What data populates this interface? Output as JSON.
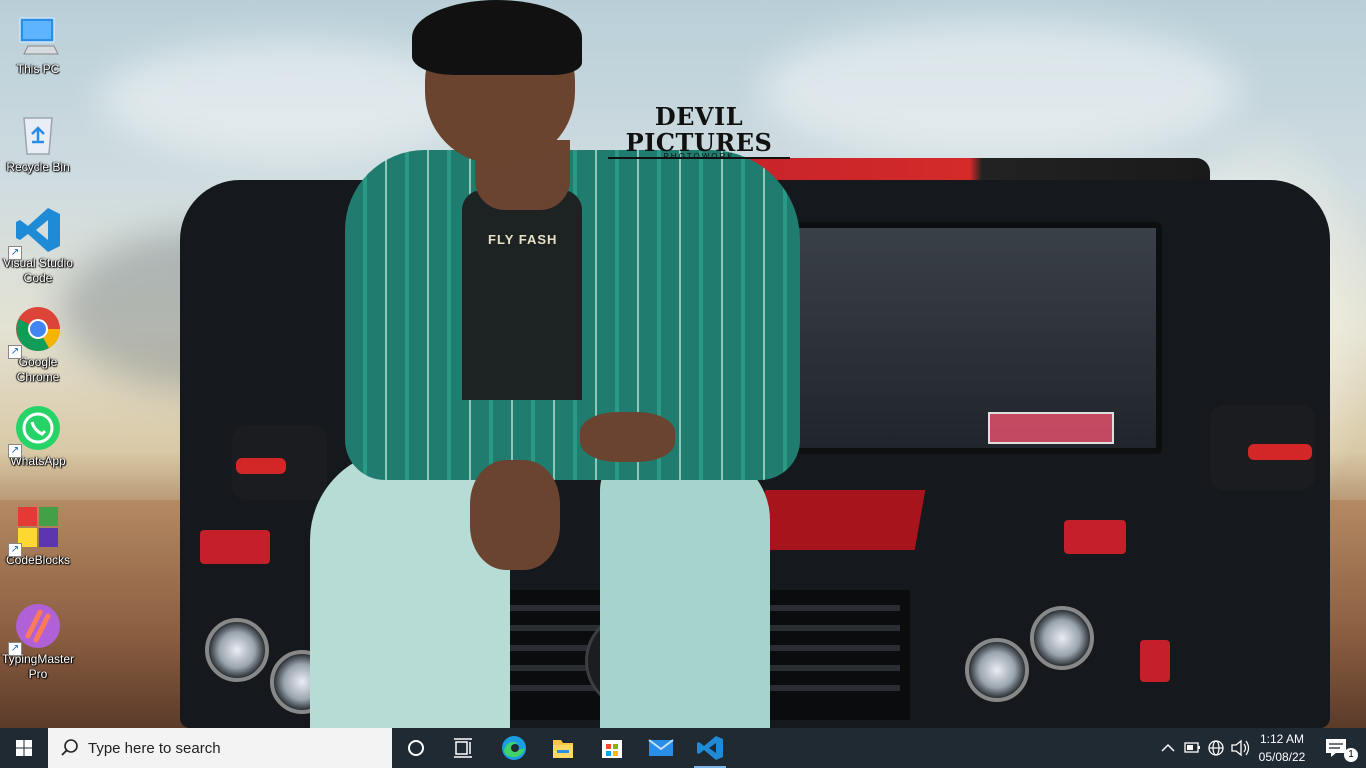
{
  "wallpaper": {
    "watermark_title": "DEVIL PICTURES",
    "watermark_subtitle": "PHOTOWORK",
    "shirt_text": "FLY FASH"
  },
  "desktop": {
    "icons": [
      {
        "label": "This PC",
        "icon": "this-pc-icon",
        "shortcut": false
      },
      {
        "label": "Recycle Bin",
        "icon": "recycle-bin-icon",
        "shortcut": false
      },
      {
        "label": "Visual Studio Code",
        "icon": "vscode-icon",
        "shortcut": true
      },
      {
        "label": "Google Chrome",
        "icon": "chrome-icon",
        "shortcut": true
      },
      {
        "label": "WhatsApp",
        "icon": "whatsapp-icon",
        "shortcut": true
      },
      {
        "label": "CodeBlocks",
        "icon": "codeblocks-icon",
        "shortcut": true
      },
      {
        "label": "TypingMaster Pro",
        "icon": "typingmaster-icon",
        "shortcut": true
      }
    ]
  },
  "taskbar": {
    "search_placeholder": "Type here to search",
    "pinned": [
      {
        "name": "cortana",
        "icon": "cortana-icon"
      },
      {
        "name": "task-view",
        "icon": "task-view-icon"
      },
      {
        "name": "edge",
        "icon": "edge-icon"
      },
      {
        "name": "file-explorer",
        "icon": "folder-icon"
      },
      {
        "name": "microsoft-store",
        "icon": "store-icon"
      },
      {
        "name": "mail",
        "icon": "mail-icon"
      },
      {
        "name": "vscode",
        "icon": "vscode-icon",
        "active": true
      }
    ],
    "tray": {
      "clock_time": "1:12 AM",
      "clock_date": "05/08/22",
      "notification_count": "1"
    }
  },
  "colors": {
    "taskbar_bg": "#1f2a33",
    "search_bg": "#f3f3f3",
    "windows_blue": "#1e90ff",
    "active_indicator": "#7fb4e6"
  }
}
